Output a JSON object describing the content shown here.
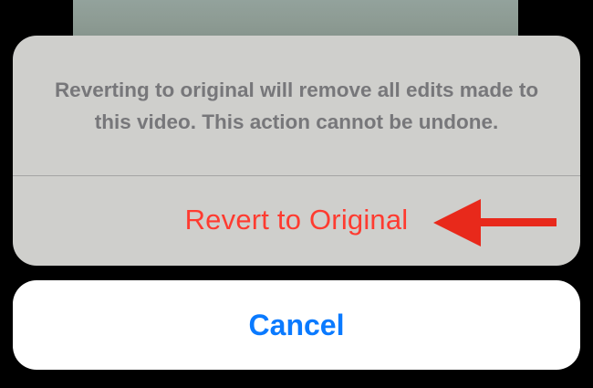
{
  "sheet": {
    "message": "Reverting to original will remove all edits made to this video. This action cannot be undone.",
    "revert_label": "Revert to Original"
  },
  "cancel": {
    "label": "Cancel"
  },
  "annotation": {
    "icon": "arrow-left-icon",
    "color": "#e8291b"
  },
  "colors": {
    "destructive": "#ff3b30",
    "accent": "#0a7aff"
  }
}
